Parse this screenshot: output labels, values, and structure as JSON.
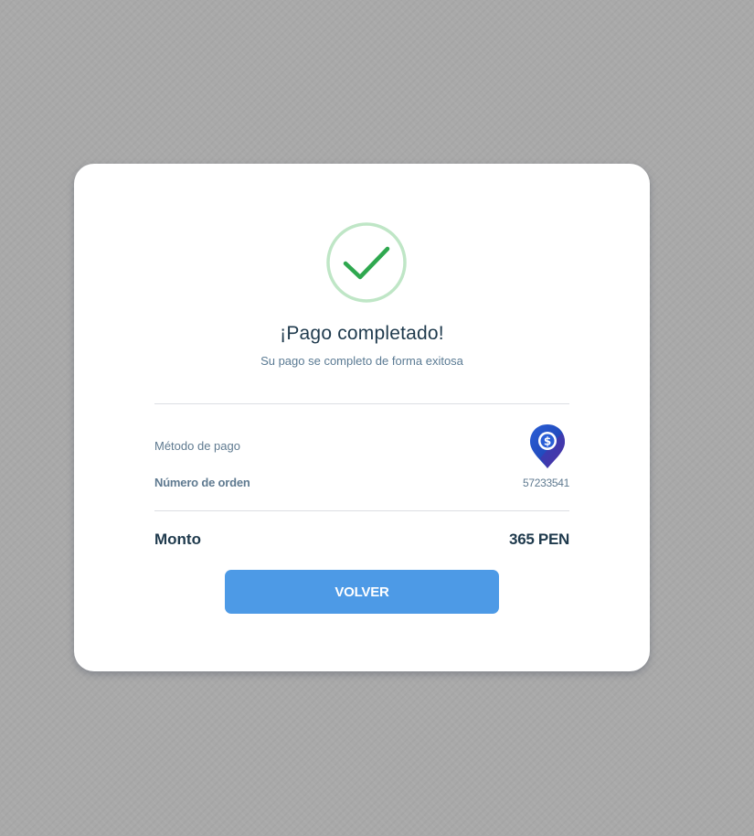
{
  "status": {
    "title": "¡Pago completado!",
    "subtitle": "Su pago se completo de forma exitosa",
    "icon": "check-circle-icon",
    "icon_color": "#2fa84f",
    "ring_color": "#bfe6c6"
  },
  "details": {
    "payment_method_label": "Método de pago",
    "payment_method_icon": "location-pin-dollar-icon",
    "order_number_label": "Número de orden",
    "order_number_value": "57233541"
  },
  "total": {
    "label": "Monto",
    "value": "365 PEN"
  },
  "actions": {
    "back_label": "VOLVER",
    "back_color": "#4d9ae6"
  }
}
